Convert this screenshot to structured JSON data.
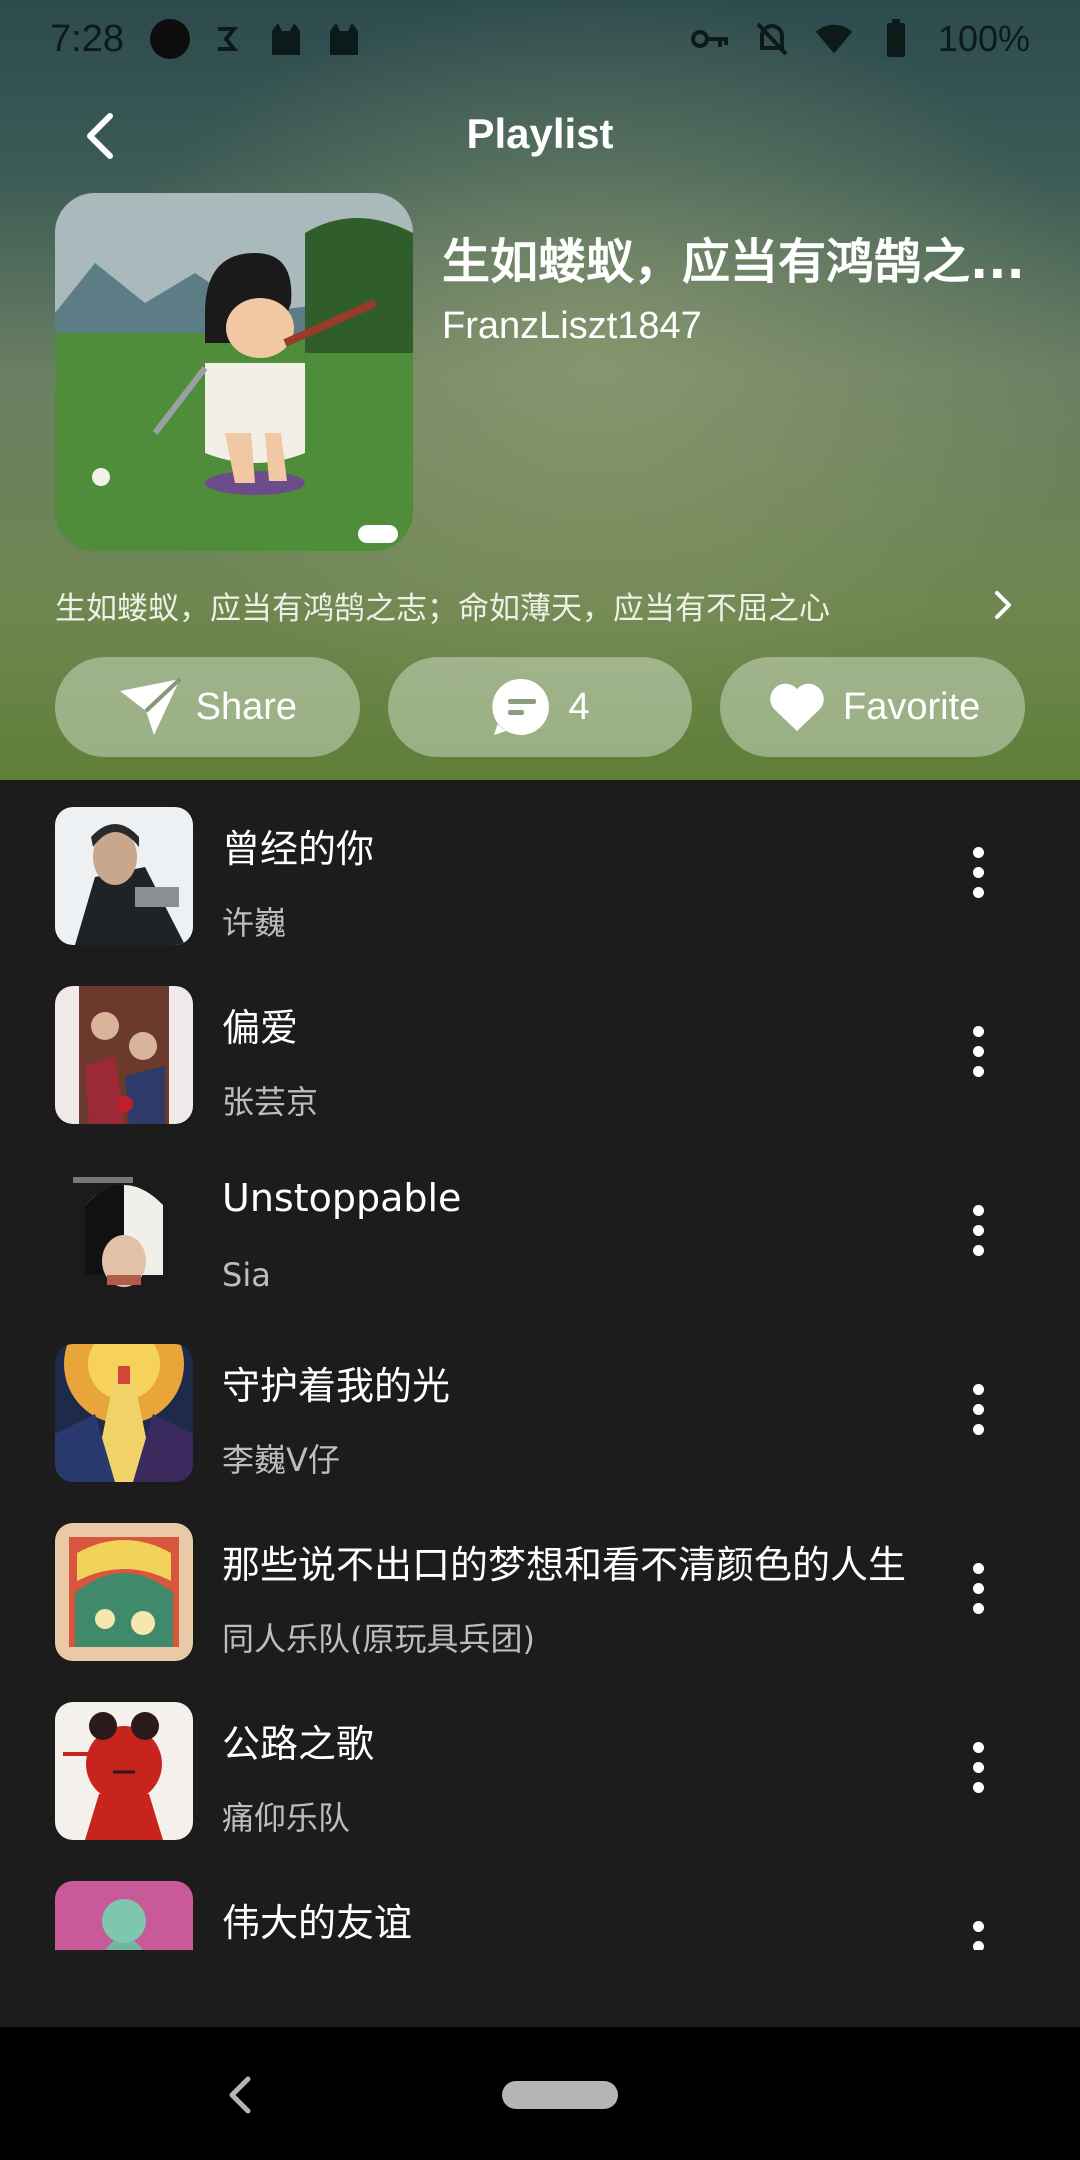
{
  "status_bar": {
    "time": "7:28",
    "battery": "100%",
    "icons": [
      "dot-icon",
      "sync-icon",
      "cat-icon",
      "cat-icon",
      "key-icon",
      "bell-off-icon",
      "wifi-icon",
      "battery-icon"
    ]
  },
  "app_bar": {
    "title": "Playlist",
    "back_icon": "back-arrow-icon"
  },
  "playlist": {
    "title": "生如蝼蚁，应当有鸿鹄之...",
    "author": "FranzLiszt1847",
    "description": "生如蝼蚁，应当有鸿鹄之志；命如薄天，应当有不屈之心"
  },
  "actions": {
    "share_label": "Share",
    "comments_count": "4",
    "favorite_label": "Favorite"
  },
  "songs": [
    {
      "title": "曾经的你",
      "artist": "许巍"
    },
    {
      "title": "偏爱",
      "artist": "张芸京"
    },
    {
      "title": "Unstoppable",
      "artist": "Sia"
    },
    {
      "title": "守护着我的光",
      "artist": "李巍V仔"
    },
    {
      "title": "那些说不出口的梦想和看不清颜色的人生",
      "artist": "同人乐队(原玩具兵团)"
    },
    {
      "title": "公路之歌",
      "artist": "痛仰乐队"
    },
    {
      "title": "伟大的友谊",
      "artist": ""
    }
  ],
  "colors": {
    "list_background": "#1c1c1c",
    "hero_top": "#2d4a4e",
    "hero_bottom": "#5f7f38",
    "artist_text": "#bdbdbd"
  }
}
